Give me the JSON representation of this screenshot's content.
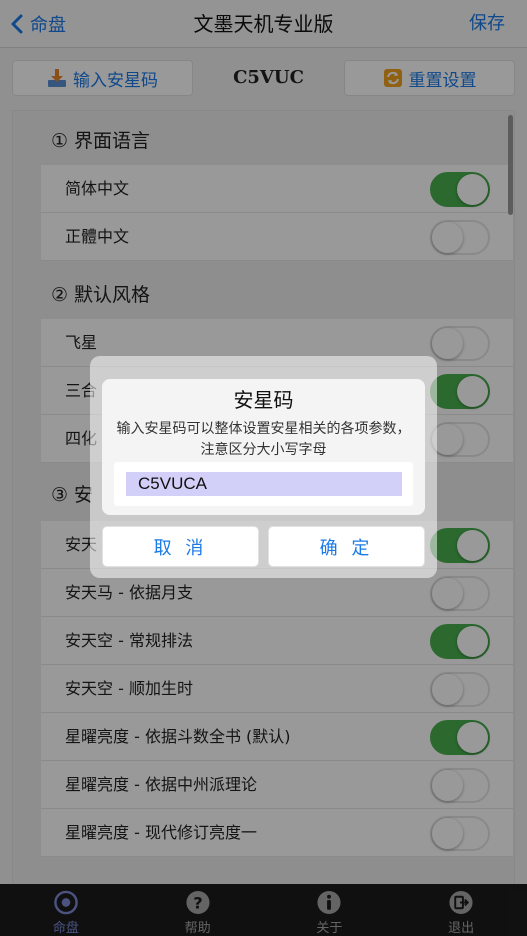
{
  "nav": {
    "back_label": "命盘",
    "title": "文墨天机专业版",
    "save_label": "保存"
  },
  "toolbar": {
    "input_code_label": "输入安星码",
    "current_code": "C5VUC",
    "reset_label": "重置设置"
  },
  "sections": [
    {
      "number": "①",
      "title": "界面语言",
      "rows": [
        {
          "label": "简体中文",
          "on": true
        },
        {
          "label": "正體中文",
          "on": false
        }
      ]
    },
    {
      "number": "②",
      "title": "默认风格",
      "rows": [
        {
          "label": "飞星",
          "on": false
        },
        {
          "label": "三合",
          "on": true
        },
        {
          "label": "四化",
          "on": false
        }
      ]
    },
    {
      "number": "③",
      "title": "安",
      "rows": [
        {
          "label": "安天",
          "on": true
        },
        {
          "label": "安天马 - 依据月支",
          "on": false
        },
        {
          "label": "安天空 - 常规排法",
          "on": true
        },
        {
          "label": "安天空 - 顺加生时",
          "on": false
        },
        {
          "label": "星曜亮度 - 依据斗数全书 (默认)",
          "on": true
        },
        {
          "label": "星曜亮度 - 依据中州派理论",
          "on": false
        },
        {
          "label": "星曜亮度 - 现代修订亮度一",
          "on": false
        }
      ]
    }
  ],
  "dialog": {
    "title": "安星码",
    "message": "输入安星码可以整体设置安星相关的各项参数，注意区分大小写字母",
    "input_value": "C5VUCA",
    "cancel_label": "取 消",
    "ok_label": "确 定"
  },
  "tabbar": {
    "items": [
      {
        "label": "命盘",
        "icon": "chart-icon",
        "active": true
      },
      {
        "label": "帮助",
        "icon": "help-icon",
        "active": false
      },
      {
        "label": "关于",
        "icon": "info-icon",
        "active": false
      },
      {
        "label": "退出",
        "icon": "exit-icon",
        "active": false
      }
    ]
  },
  "colors": {
    "accent_blue": "#1a7ae8",
    "switch_on": "#48b04f",
    "tab_active": "#7d8bd8"
  }
}
